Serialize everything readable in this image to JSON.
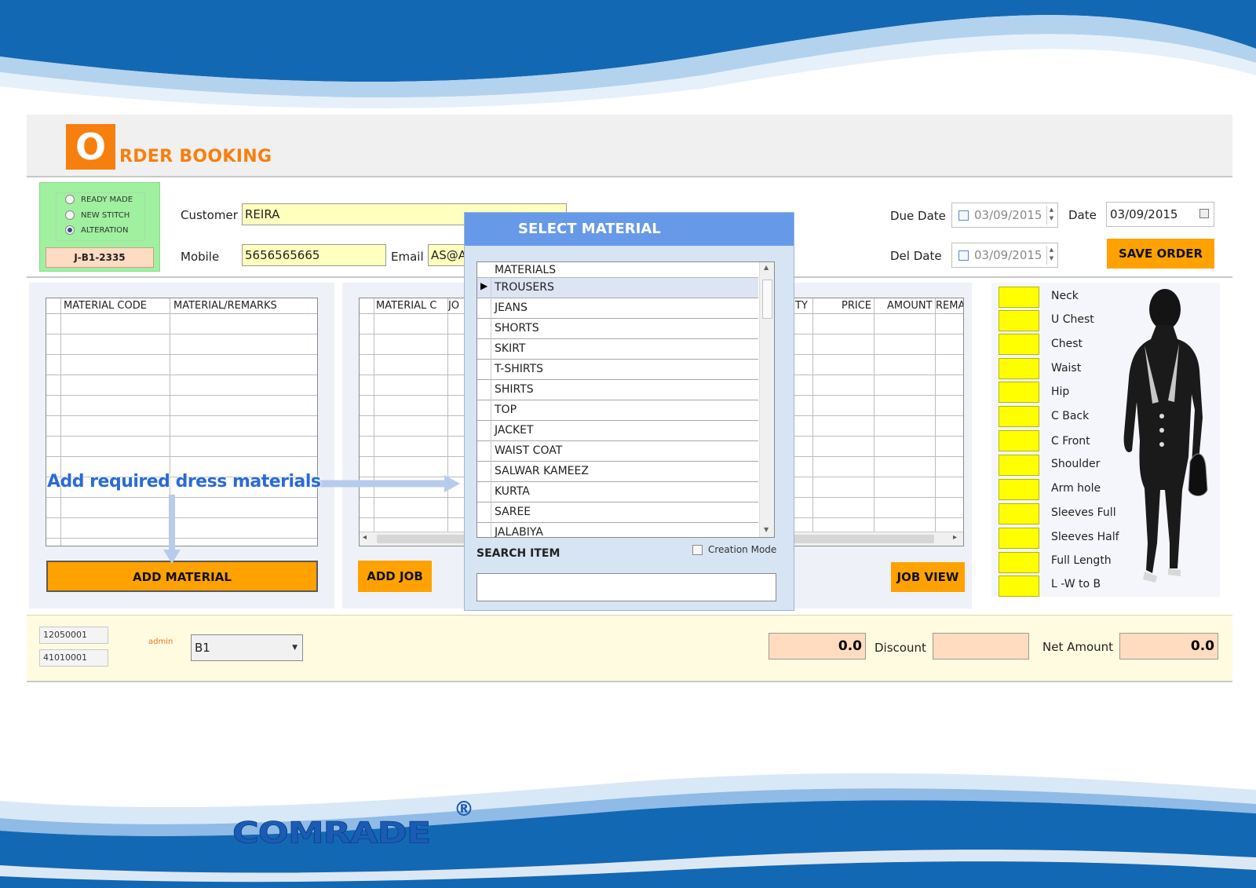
{
  "header": {
    "title_initial": "O",
    "title_rest": "RDER BOOKING"
  },
  "order_type": {
    "options": [
      "READY MADE",
      "NEW STITCH",
      "ALTERATION"
    ],
    "selected": "ALTERATION",
    "job_number": "J-B1-2335"
  },
  "customer": {
    "customer_label": "Customer",
    "customer_value": "REIRA",
    "mobile_label": "Mobile",
    "mobile_value": "5656565665",
    "email_label": "Email",
    "email_value": "AS@A"
  },
  "dates": {
    "due_label": "Due Date",
    "due_value": "03/09/2015",
    "del_label": "Del Date",
    "del_value": "03/09/2015",
    "date_label": "Date",
    "date_value": "03/09/2015"
  },
  "buttons": {
    "save_order": "SAVE ORDER",
    "add_material": "ADD MATERIAL",
    "add_job": "ADD JOB",
    "job_view": "JOB VIEW"
  },
  "material_grid": {
    "columns": [
      "MATERIAL CODE",
      "MATERIAL/REMARKS"
    ]
  },
  "job_grid": {
    "columns": [
      "MATERIAL C",
      "JO",
      "TY",
      "PRICE",
      "AMOUNT",
      "REMA"
    ]
  },
  "annotation": "Add required dress materials",
  "dialog": {
    "title": "SELECT MATERIAL",
    "list_header": "MATERIALS",
    "items": [
      "TROUSERS",
      "JEANS",
      "SHORTS",
      "SKIRT",
      "T-SHIRTS",
      "SHIRTS",
      "TOP",
      "JACKET",
      "WAIST COAT",
      "SALWAR KAMEEZ",
      "KURTA",
      "SAREE",
      "JALABIYA"
    ],
    "selected_item": "TROUSERS",
    "search_label": "SEARCH ITEM",
    "search_value": "",
    "creation_mode": "Creation Mode"
  },
  "measurements": [
    "Neck",
    "U Chest",
    "Chest",
    "Waist",
    "Hip",
    "C Back",
    "C Front",
    "Shoulder",
    "Arm hole",
    "Sleeves Full",
    "Sleeves Half",
    "Full Length",
    "L -W to B"
  ],
  "footer": {
    "code1": "12050001",
    "code2": "41010001",
    "user": "admin",
    "branch": "B1",
    "total_value": "0.0",
    "discount_label": "Discount",
    "discount_value": "",
    "net_amount_label": "Net Amount",
    "net_amount_value": "0.0"
  },
  "brand": {
    "logo_text": "COMRADE",
    "registered": "®"
  },
  "colors": {
    "accent_orange": "#ffa200",
    "brand_blue": "#1565b8",
    "dialog_blue": "#6799e9",
    "measure_yellow": "#ffff00"
  }
}
